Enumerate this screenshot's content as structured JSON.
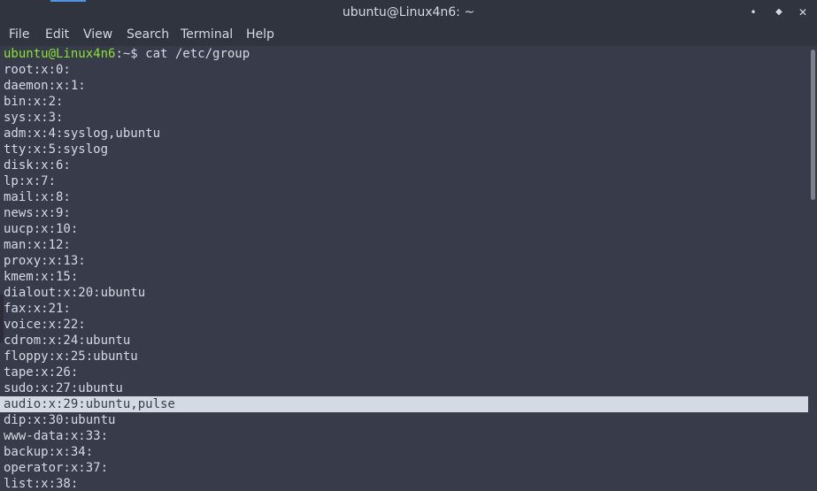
{
  "window": {
    "title": "ubuntu@Linux4n6: ~",
    "minimize_glyph": "•",
    "maximize_glyph": "◆",
    "close_glyph": "✕"
  },
  "menu": {
    "file": "File",
    "edit": "Edit",
    "view": "View",
    "search": "Search",
    "terminal": "Terminal",
    "help": "Help"
  },
  "terminal": {
    "prompt_user_host": "ubuntu@Linux4n6",
    "prompt_rest": ":~$ cat /etc/group",
    "lines": [
      "root:x:0:",
      "daemon:x:1:",
      "bin:x:2:",
      "sys:x:3:",
      "adm:x:4:syslog,ubuntu",
      "tty:x:5:syslog",
      "disk:x:6:",
      "lp:x:7:",
      "mail:x:8:",
      "news:x:9:",
      "uucp:x:10:",
      "man:x:12:",
      "proxy:x:13:",
      "kmem:x:15:",
      "dialout:x:20:ubuntu",
      "fax:x:21:",
      "voice:x:22:",
      "cdrom:x:24:ubuntu",
      "floppy:x:25:ubuntu",
      "tape:x:26:",
      "sudo:x:27:ubuntu",
      "audio:x:29:ubuntu,pulse",
      "dip:x:30:ubuntu",
      "www-data:x:33:",
      "backup:x:34:",
      "operator:x:37:",
      "list:x:38:"
    ]
  },
  "colors": {
    "background": "#383c4a",
    "titlebar": "#2f343f",
    "text": "#d3dae3",
    "prompt_user": "#8ae234",
    "selection": "#d3dae3",
    "scroll_thumb": "#7c818c"
  }
}
